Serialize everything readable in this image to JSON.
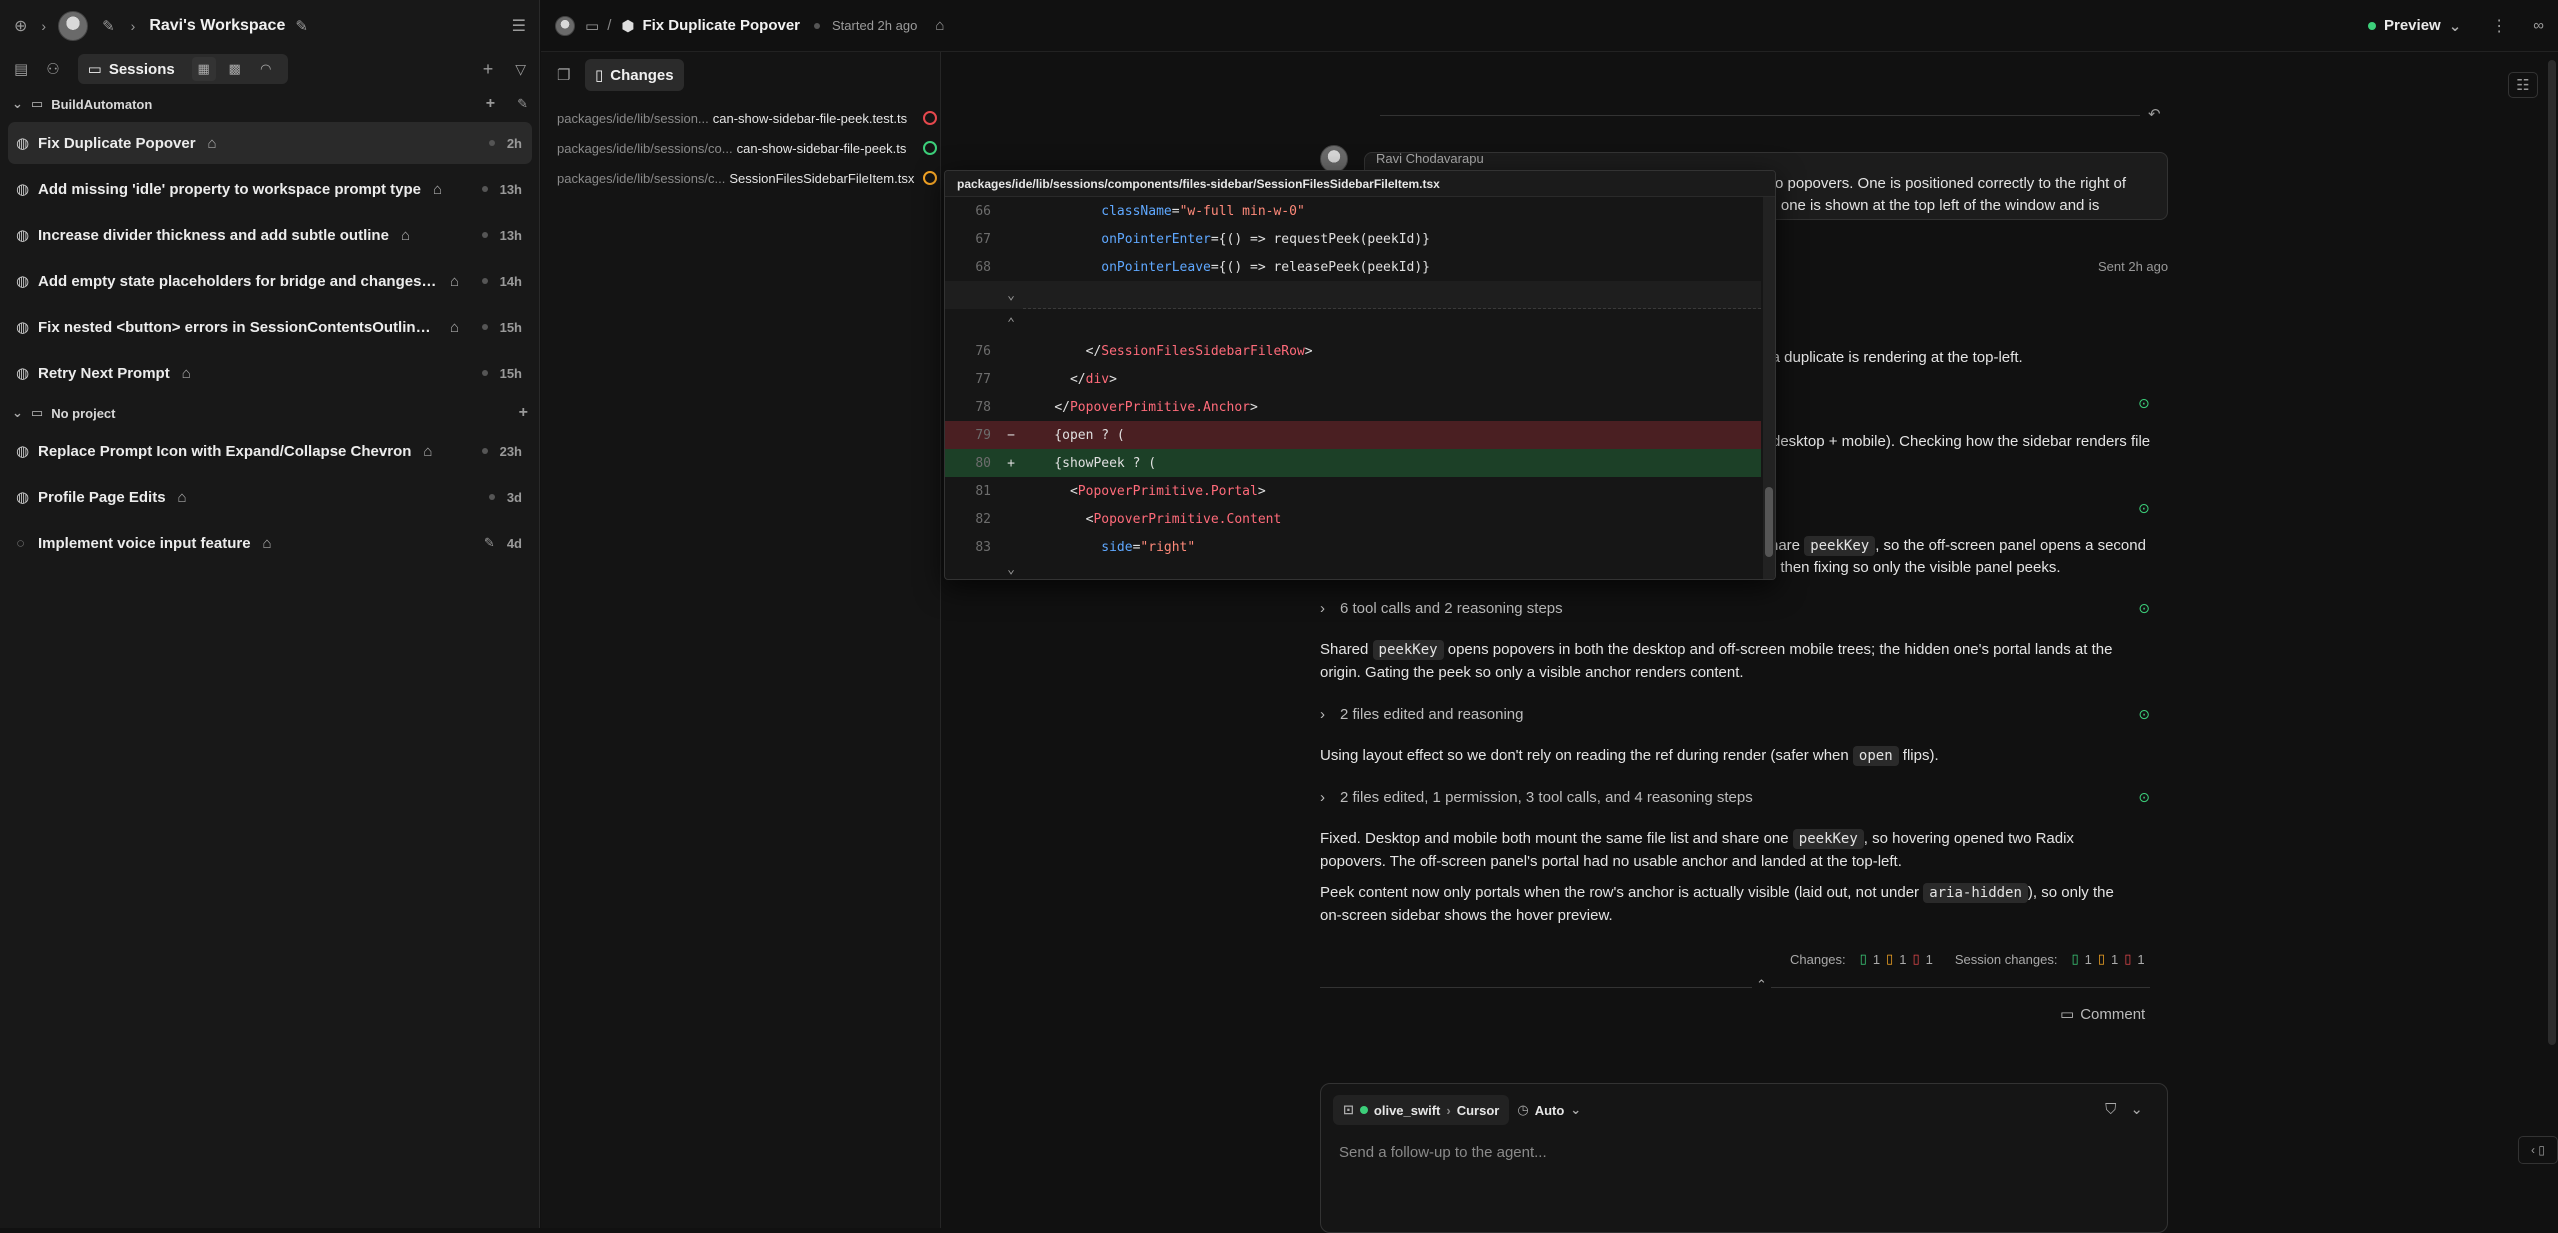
{
  "sidebar": {
    "workspace_title": "Ravi's Workspace",
    "sessions_tab": "Sessions",
    "groups": [
      {
        "name": "BuildAutomaton",
        "sessions": [
          {
            "title": "Fix Duplicate Popover",
            "time": "2h",
            "active": true
          },
          {
            "title": "Add missing 'idle' property to workspace prompt type",
            "time": "13h"
          },
          {
            "title": "Increase divider thickness and add subtle outline",
            "time": "13h"
          },
          {
            "title": "Add empty state placeholders for bridge and changes tabs",
            "time": "14h"
          },
          {
            "title": "Fix nested <button> errors in SessionContentsOutline co...",
            "time": "15h"
          },
          {
            "title": "Retry Next Prompt",
            "time": "15h"
          }
        ]
      },
      {
        "name": "No project",
        "sessions": [
          {
            "title": "Replace Prompt Icon with Expand/Collapse Chevron",
            "time": "23h"
          },
          {
            "title": "Profile Page Edits",
            "time": "3d"
          },
          {
            "title": "Implement voice input feature",
            "time": "4d"
          }
        ]
      }
    ]
  },
  "header": {
    "separator": "/",
    "title": "Fix Duplicate Popover",
    "started": "Started 2h ago",
    "preview": "Preview"
  },
  "files_panel": {
    "tab": "Changes",
    "files": [
      {
        "path": "packages/ide/lib/session...",
        "name": "can-show-sidebar-file-peek.test.ts",
        "status_color": "#e5484d"
      },
      {
        "path": "packages/ide/lib/sessions/co...",
        "name": "can-show-sidebar-file-peek.ts",
        "status_color": "#3ccf7a"
      },
      {
        "path": "packages/ide/lib/sessions/c...",
        "name": "SessionFilesSidebarFileItem.tsx",
        "status_color": "#f5a524"
      }
    ]
  },
  "popover": {
    "path": "packages/ide/lib/sessions/components/files-sidebar/SessionFilesSidebarFileItem.tsx",
    "lines": [
      {
        "n": "66",
        "code": "          className=\"w-full min-w-0\""
      },
      {
        "n": "67",
        "code": "          onPointerEnter={() => requestPeek(peekId)}"
      },
      {
        "n": "68",
        "code": "          onPointerLeave={() => releasePeek(peekId)}"
      },
      {
        "n": "76",
        "code": "        </SessionFilesSidebarFileRow>"
      },
      {
        "n": "77",
        "code": "      </div>"
      },
      {
        "n": "78",
        "code": "    </PopoverPrimitive.Anchor>"
      },
      {
        "n": "79",
        "mark": "−",
        "code": "    {open ? ("
      },
      {
        "n": "80",
        "mark": "+",
        "code": "    {showPeek ? ("
      },
      {
        "n": "81",
        "code": "      <PopoverPrimitive.Portal>"
      },
      {
        "n": "82",
        "code": "        <PopoverPrimitive.Content"
      },
      {
        "n": "83",
        "code": "          side=\"right\""
      }
    ]
  },
  "conversation": {
    "author": "Ravi Chodavarapu",
    "msg_line1": "two popovers. One is positioned correctly to the right of",
    "msg_line2": "nd one is shown at the top left of the window and is",
    "sent": "Sent 2h ago",
    "frag1": "y a duplicate is rendering at the top-left.",
    "frag2": "desktop + mobile). Checking how the sidebar renders file",
    "frag3a": "hare",
    "frag3_code": "peekKey",
    "frag3b": ", so the off-screen panel opens a second",
    "frag4": "; then fixing so only the visible panel peeks.",
    "step1": "6 tool calls and 2 reasoning steps",
    "p1a": "Shared",
    "p1_code": "peekKey",
    "p1b": "opens popovers in both the desktop and off-screen mobile trees; the hidden one's portal lands at the",
    "p1c": "origin. Gating the peek so only a visible anchor renders content.",
    "step2": "2 files edited and reasoning",
    "p2a": "Using layout effect so we don't rely on reading the ref during render (safer when",
    "p2_code": "open",
    "p2b": "flips).",
    "step3": "2 files edited, 1 permission, 3 tool calls, and 4 reasoning steps",
    "p3a": "Fixed. Desktop and mobile both mount the same file list and share one",
    "p3_code": "peekKey",
    "p3b": ", so hovering opened two Radix",
    "p3c": "popovers. The off-screen panel's portal had no usable anchor and landed at the top-left.",
    "p4a": "Peek content now only portals when the row's anchor is actually visible (laid out, not under",
    "p4_code": "aria-hidden",
    "p4b": "), so only the",
    "p4c": "on-screen sidebar shows the hover preview.",
    "changes_label": "Changes:",
    "session_changes_label": "Session changes:",
    "count_added": "1",
    "count_modified": "1",
    "count_deleted": "1",
    "comment": "Comment"
  },
  "composer": {
    "user": "olive_swift",
    "agent": "Cursor",
    "mode": "Auto",
    "placeholder": "Send a follow-up to the agent..."
  }
}
